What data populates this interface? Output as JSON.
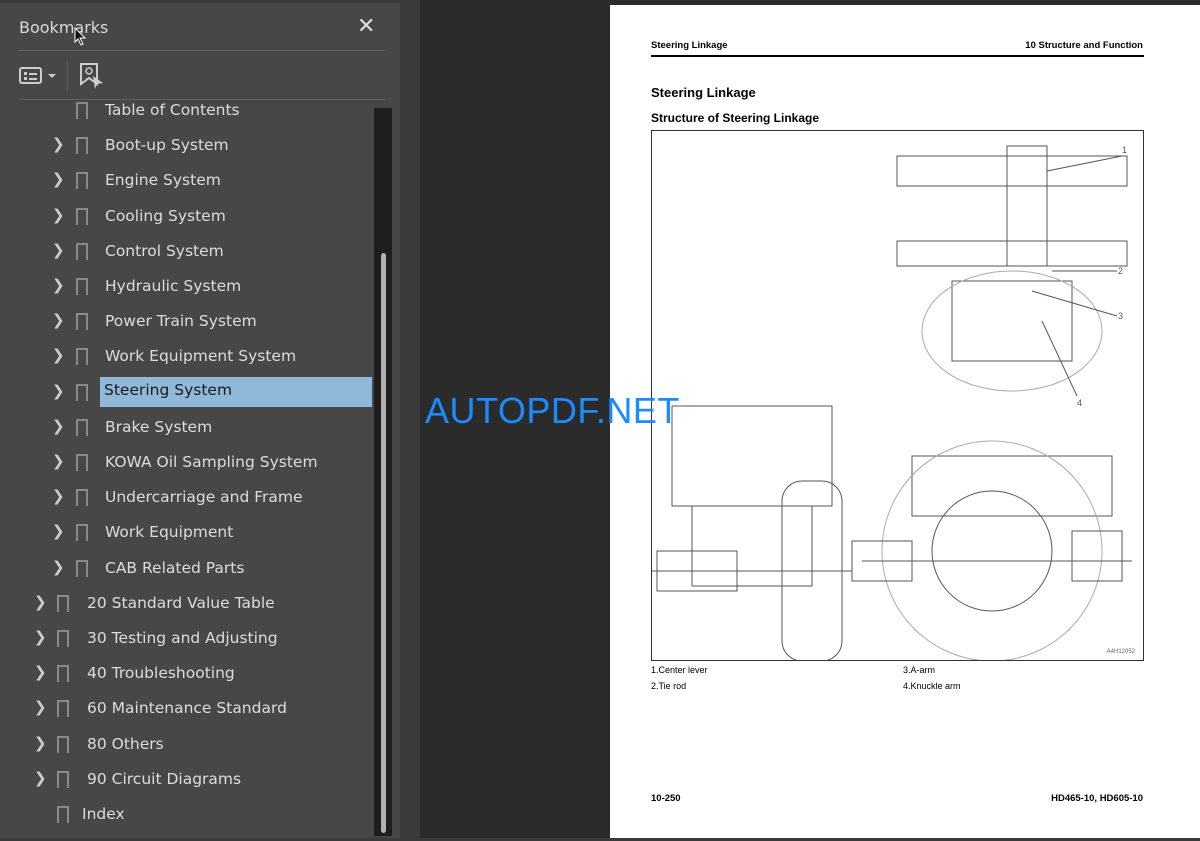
{
  "panel": {
    "title": "Bookmarks",
    "close_icon": "close-icon",
    "options_icon": "list-options-icon",
    "find_icon": "find-bookmark-icon"
  },
  "bookmarks": [
    {
      "label": "Table of Contents",
      "level": 2,
      "expandable": false
    },
    {
      "label": "Boot-up System",
      "level": 2,
      "expandable": true
    },
    {
      "label": "Engine System",
      "level": 2,
      "expandable": true
    },
    {
      "label": "Cooling System",
      "level": 2,
      "expandable": true
    },
    {
      "label": "Control System",
      "level": 2,
      "expandable": true
    },
    {
      "label": "Hydraulic System",
      "level": 2,
      "expandable": true
    },
    {
      "label": "Power Train System",
      "level": 2,
      "expandable": true
    },
    {
      "label": "Work Equipment System",
      "level": 2,
      "expandable": true
    },
    {
      "label": "Steering System",
      "level": 2,
      "expandable": true,
      "selected": true
    },
    {
      "label": "Brake System",
      "level": 2,
      "expandable": true
    },
    {
      "label": "KOWA Oil Sampling System",
      "level": 2,
      "expandable": true
    },
    {
      "label": "Undercarriage and Frame",
      "level": 2,
      "expandable": true
    },
    {
      "label": "Work Equipment",
      "level": 2,
      "expandable": true
    },
    {
      "label": "CAB Related Parts",
      "level": 2,
      "expandable": true
    },
    {
      "label": "20 Standard Value Table",
      "level": 1,
      "expandable": true
    },
    {
      "label": "30 Testing and Adjusting",
      "level": 1,
      "expandable": true
    },
    {
      "label": "40 Troubleshooting",
      "level": 1,
      "expandable": true
    },
    {
      "label": "60 Maintenance Standard",
      "level": 1,
      "expandable": true
    },
    {
      "label": "80 Others",
      "level": 1,
      "expandable": true
    },
    {
      "label": "90 Circuit Diagrams",
      "level": 1,
      "expandable": true
    },
    {
      "label": "Index",
      "level": 1,
      "expandable": false
    }
  ],
  "watermark": "AUTOPDF.NET",
  "page": {
    "header_left": "Steering Linkage",
    "header_right": "10 Structure and Function",
    "title": "Steering Linkage",
    "subtitle": "Structure of Steering Linkage",
    "figure_code": "A4H12052",
    "legend": [
      "1.Center lever",
      "2.Tie rod",
      "3.A-arm",
      "4.Knuckle arm"
    ],
    "footer_left": "10-250",
    "footer_right": "HD465-10, HD605-10"
  },
  "colors": {
    "selection": "#8fb8d9",
    "watermark": "#1a8cff"
  }
}
